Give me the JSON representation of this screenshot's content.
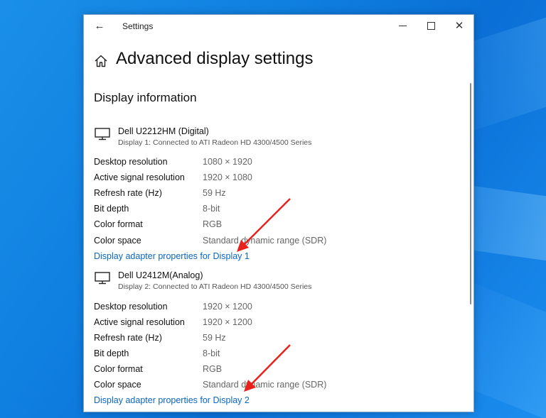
{
  "window": {
    "title": "Settings",
    "back_glyph": "←",
    "min_label": "",
    "close_glyph": "✕"
  },
  "page": {
    "title": "Advanced display settings",
    "section_title": "Display information"
  },
  "labels": {
    "desktop_resolution": "Desktop resolution",
    "active_signal_resolution": "Active signal resolution",
    "refresh_rate": "Refresh rate (Hz)",
    "bit_depth": "Bit depth",
    "color_format": "Color format",
    "color_space": "Color space"
  },
  "displays": [
    {
      "name": "Dell U2212HM (Digital)",
      "subtitle": "Display 1: Connected to ATI Radeon HD 4300/4500 Series",
      "desktop_resolution": "1080 × 1920",
      "active_signal_resolution": "1920 × 1080",
      "refresh_rate": "59 Hz",
      "bit_depth": "8-bit",
      "color_format": "RGB",
      "color_space": "Standard dynamic range (SDR)",
      "adapter_link": "Display adapter properties for Display 1"
    },
    {
      "name": "Dell U2412M(Analog)",
      "subtitle": "Display 2: Connected to ATI Radeon HD 4300/4500 Series",
      "desktop_resolution": "1920 × 1200",
      "active_signal_resolution": "1920 × 1200",
      "refresh_rate": "59 Hz",
      "bit_depth": "8-bit",
      "color_format": "RGB",
      "color_space": "Standard dynamic range (SDR)",
      "adapter_link": "Display adapter properties for Display 2"
    }
  ],
  "colors": {
    "link": "#0a66c2",
    "annotation_arrow": "#e8211c",
    "desktop_blue": "#0f7fe0"
  },
  "icons": {
    "back": "back-arrow-icon",
    "home": "home-icon",
    "monitor": "monitor-icon",
    "minimize": "minimize-icon",
    "maximize": "maximize-icon",
    "close": "close-icon"
  }
}
